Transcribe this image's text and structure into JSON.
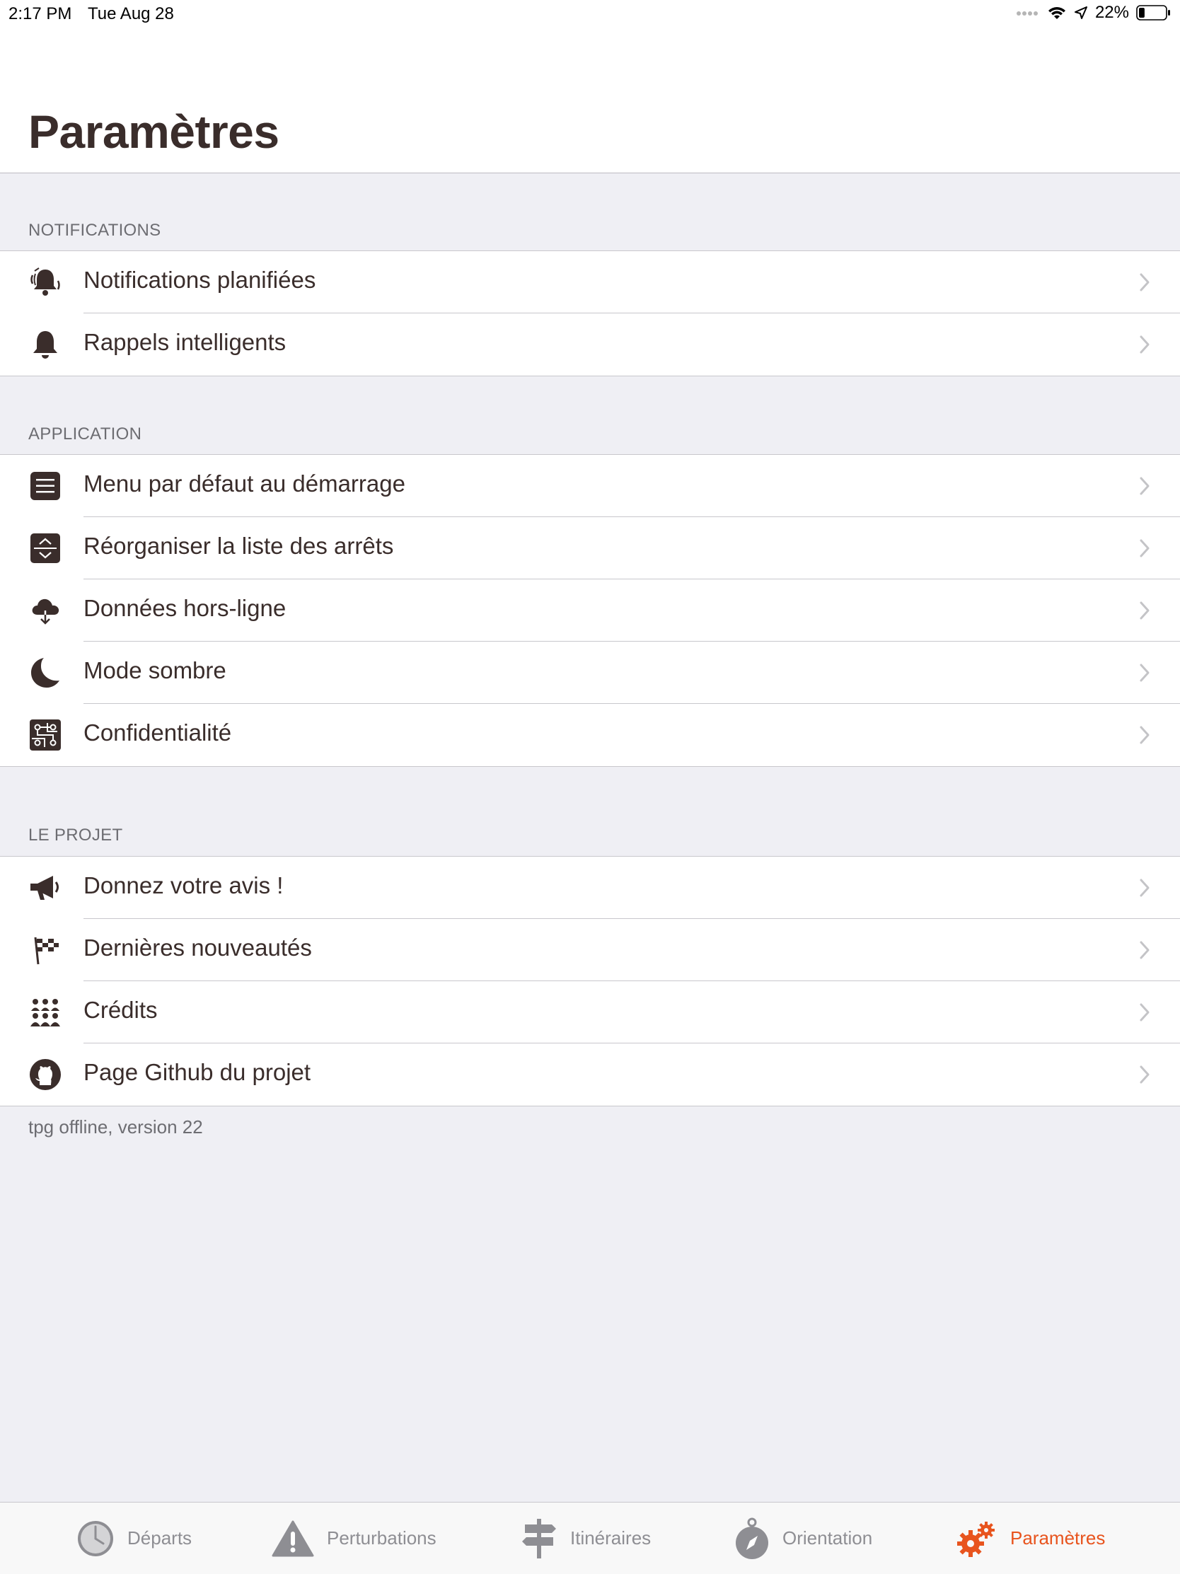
{
  "status_bar": {
    "time": "2:17 PM",
    "date": "Tue Aug 28",
    "battery": "22%",
    "battery_level": 0.22
  },
  "page": {
    "title": "Paramètres"
  },
  "colors": {
    "accent": "#e8541e",
    "icon": "#3a2d2b",
    "tab_inactive": "#8e8e93"
  },
  "sections": [
    {
      "header": "NOTIFICATIONS",
      "items": [
        {
          "label": "Notifications planifiées",
          "icon": "bell-ringing-icon"
        },
        {
          "label": "Rappels intelligents",
          "icon": "bell-icon"
        }
      ]
    },
    {
      "header": "APPLICATION",
      "items": [
        {
          "label": "Menu par défaut au démarrage",
          "icon": "menu-icon"
        },
        {
          "label": "Réorganiser la liste des arrêts",
          "icon": "reorder-icon"
        },
        {
          "label": "Données hors-ligne",
          "icon": "cloud-download-icon"
        },
        {
          "label": "Mode sombre",
          "icon": "moon-icon"
        },
        {
          "label": "Confidentialité",
          "icon": "circuit-icon"
        }
      ]
    },
    {
      "header": "LE PROJET",
      "items": [
        {
          "label": "Donnez votre avis !",
          "icon": "megaphone-icon"
        },
        {
          "label": "Dernières nouveautés",
          "icon": "flags-icon"
        },
        {
          "label": "Crédits",
          "icon": "people-icon"
        },
        {
          "label": "Page Github du projet",
          "icon": "github-icon"
        }
      ]
    }
  ],
  "footer": {
    "version": "tpg offline, version 22"
  },
  "tabs": [
    {
      "label": "Départs",
      "icon": "clock-icon",
      "active": false
    },
    {
      "label": "Perturbations",
      "icon": "warning-icon",
      "active": false
    },
    {
      "label": "Itinéraires",
      "icon": "signpost-icon",
      "active": false
    },
    {
      "label": "Orientation",
      "icon": "compass-icon",
      "active": false
    },
    {
      "label": "Paramètres",
      "icon": "gears-icon",
      "active": true
    }
  ]
}
